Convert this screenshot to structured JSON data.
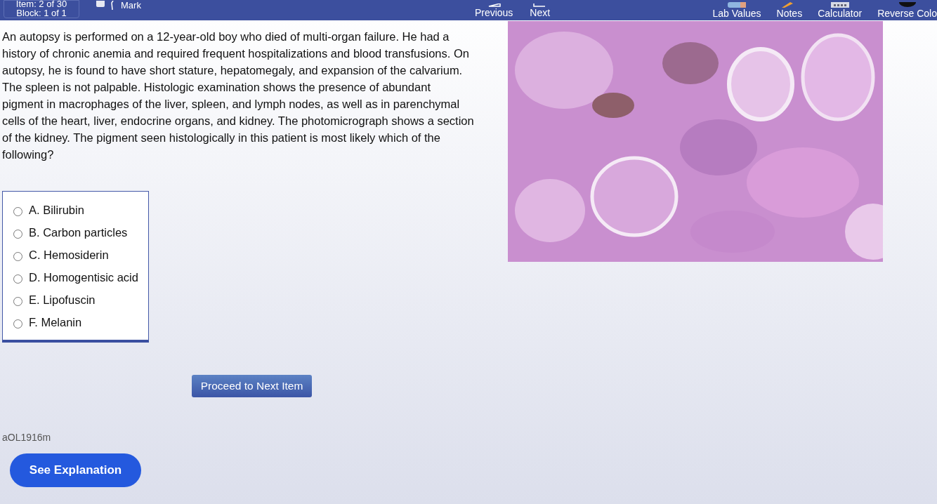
{
  "header": {
    "item": "Item: 2 of 30",
    "block": "Block: 1 of 1",
    "mark": {
      "label": "Mark",
      "checked": false
    },
    "nav": [
      {
        "label": "Previous",
        "kind": "previous"
      },
      {
        "label": "Next",
        "kind": "next"
      }
    ],
    "tools": [
      {
        "label": "Lab Values",
        "kind": "lab"
      },
      {
        "label": "Notes",
        "kind": "notes"
      },
      {
        "label": "Calculator",
        "kind": "calculator"
      },
      {
        "label": "Reverse Colo",
        "kind": "reverse"
      }
    ]
  },
  "question": {
    "stem": "An autopsy is performed on a 12-year-old boy who died of multi-organ failure. He had a history of chronic anemia and required frequent hospitalizations and blood transfusions. On autopsy, he is found to have short stature, hepatomegaly, and expansion of the calvarium. The spleen is not palpable. Histologic examination shows the presence of abundant pigment in macrophages of the liver, spleen, and lymph nodes, as well as in parenchymal cells of the heart, liver, endocrine organs, and kidney. The photomicrograph shows a section of the kidney. The pigment seen histologically in this patient is most likely which of the following?"
  },
  "options": [
    {
      "label": "A. Bilirubin",
      "selected": false
    },
    {
      "label": "B. Carbon particles",
      "selected": false
    },
    {
      "label": "C. Hemosiderin",
      "selected": false
    },
    {
      "label": "D. Homogentisic acid",
      "selected": false
    },
    {
      "label": "E. Lipofuscin",
      "selected": false
    },
    {
      "label": "F. Melanin",
      "selected": false
    }
  ],
  "proceed_button": "Proceed to Next Item",
  "question_id": "aOL1916m",
  "explanation_button": "See Explanation"
}
